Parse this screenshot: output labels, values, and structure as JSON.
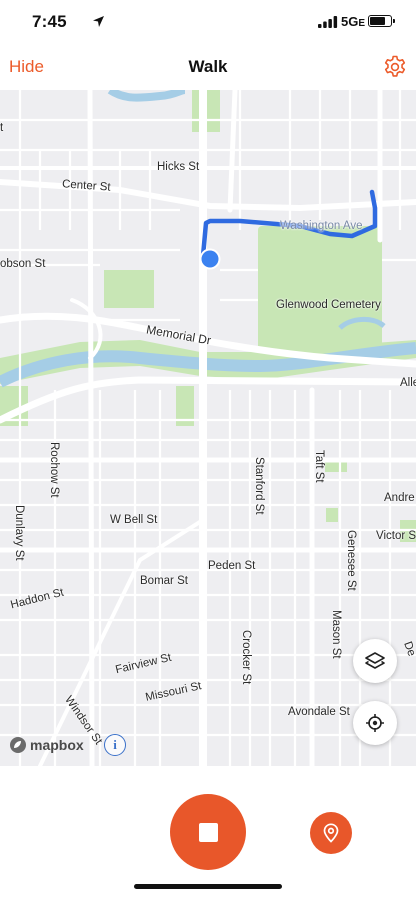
{
  "status_bar": {
    "time": "7:45",
    "network": "5G",
    "network_suffix": "E"
  },
  "nav": {
    "back_label": "Hide",
    "title": "Walk",
    "settings_icon": "gear-icon"
  },
  "map": {
    "labels": {
      "hicks": "Hicks St",
      "center": "Center St",
      "washington": "Washington Ave",
      "robson": "obson St",
      "st_partial": "t",
      "memorial": "Memorial Dr",
      "glenwood": "Glenwood Cemetery",
      "allen": "Alle",
      "rochow": "Rochow St",
      "stanford": "Stanford St",
      "taft": "Taft St",
      "andrew": "Andre",
      "dunlavy": "Dunlavy St",
      "w_bell": "W Bell St",
      "victor": "Victor S",
      "genesee": "Genesee St",
      "peden": "Peden St",
      "bomar": "Bomar St",
      "haddon": "Haddon St",
      "mason": "Mason St",
      "crocker": "Crocker St",
      "fairview": "Fairview St",
      "de": "De",
      "missouri": "Missouri St",
      "windsor": "Windsor St",
      "avondale": "Avondale St"
    },
    "attribution": "mapbox",
    "info_glyph": "i",
    "layers_icon": "layers-icon",
    "recenter_icon": "crosshair-icon",
    "colors": {
      "background": "#eeeef1",
      "road": "#ffffff",
      "park": "#c8e6b5",
      "water": "#a5cde6",
      "route": "#2f6ae0",
      "position": "#3b82f0"
    }
  },
  "controls": {
    "stop_icon": "stop-icon",
    "waypoint_icon": "location-pin-icon",
    "accent": "#e8572a"
  }
}
